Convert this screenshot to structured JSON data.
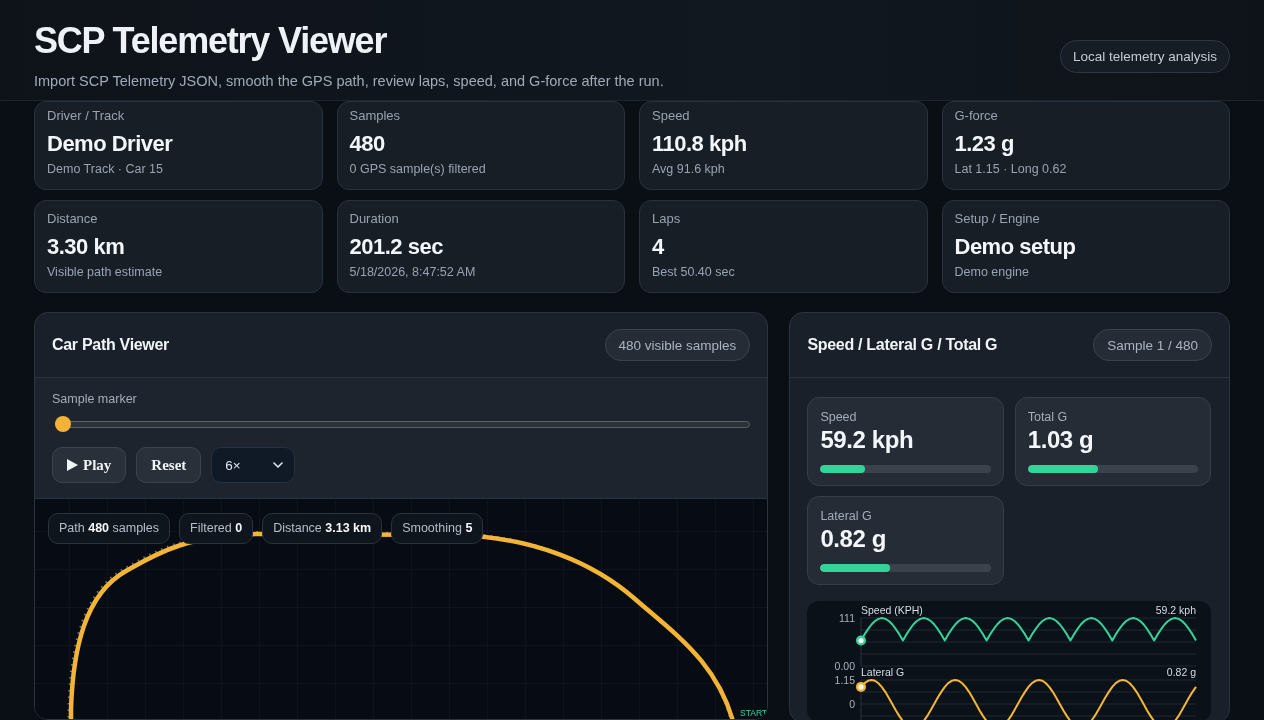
{
  "header": {
    "title": "SCP Telemetry Viewer",
    "subtitle": "Import SCP Telemetry JSON, smooth the GPS path, review laps, speed, and G-force after the run.",
    "badge": "Local telemetry analysis"
  },
  "stats": [
    {
      "label": "Driver / Track",
      "value": "Demo Driver",
      "detail": "Demo Track · Car 15"
    },
    {
      "label": "Samples",
      "value": "480",
      "detail": "0 GPS sample(s) filtered"
    },
    {
      "label": "Speed",
      "value": "110.8 kph",
      "detail": "Avg 91.6 kph"
    },
    {
      "label": "G-force",
      "value": "1.23 g",
      "detail": "Lat 1.15 · Long 0.62"
    },
    {
      "label": "Distance",
      "value": "3.30 km",
      "detail": "Visible path estimate"
    },
    {
      "label": "Duration",
      "value": "201.2 sec",
      "detail": "5/18/2026, 8:47:52 AM"
    },
    {
      "label": "Laps",
      "value": "4",
      "detail": "Best 50.40 sec"
    },
    {
      "label": "Setup / Engine",
      "value": "Demo setup",
      "detail": "Demo engine"
    }
  ],
  "path_viewer": {
    "title": "Car Path Viewer",
    "badge": "480 visible samples",
    "slider": {
      "label": "Sample marker",
      "level": 0
    },
    "buttons": [
      {
        "kind": "play",
        "label": "Play"
      },
      {
        "kind": "reset",
        "label": "Reset"
      }
    ],
    "speed_select": {
      "value": "6×"
    },
    "chips": [
      "Path **480** samples",
      "Filtered **0**",
      "Distance **3.13 km**",
      "Smoothing **5**"
    ],
    "start_label": "START"
  },
  "telemetry": {
    "title": "Speed / Lateral G / Total G",
    "badge": "Sample 1 / 480",
    "metrics": [
      {
        "label": "Speed",
        "value": "59.2 kph",
        "level": 0.26
      },
      {
        "label": "Total G",
        "value": "1.03 g",
        "level": 0.41
      },
      {
        "label": "Lateral G",
        "value": "0.82 g",
        "level": 0.41
      }
    ],
    "charts": [
      {
        "reading": "59.2 kph",
        "chart_data": {
          "type": "line",
          "title": "Speed (KPH)",
          "categories": [
            null,
            null,
            null,
            null,
            null,
            null,
            null,
            null,
            null,
            null,
            null,
            null,
            null,
            null,
            null,
            null,
            null,
            null,
            null,
            null,
            null,
            null,
            null,
            null,
            null,
            null,
            null,
            null,
            null,
            null,
            null,
            null,
            null,
            null,
            null,
            null,
            null,
            null,
            null,
            null,
            null,
            null,
            null,
            null,
            null,
            null,
            null,
            null,
            null,
            null,
            null,
            null,
            null,
            null,
            null,
            null,
            null,
            null,
            null,
            null,
            null,
            null,
            null,
            null,
            null,
            null,
            null,
            null,
            null,
            null,
            null,
            null,
            null,
            null,
            null,
            null,
            null,
            null,
            null,
            null,
            null,
            null,
            null,
            null,
            null,
            null,
            null,
            null,
            null,
            null,
            null,
            null,
            null,
            null,
            null,
            null,
            null
          ],
          "series": [
            {
              "color": "#34d399",
              "values": [
                59,
                73,
                85,
                96,
                104,
                109,
                111,
                109,
                104,
                96,
                85,
                73,
                59,
                73,
                85,
                96,
                104,
                109,
                111,
                109,
                104,
                96,
                85,
                73,
                59,
                73,
                85,
                96,
                104,
                109,
                111,
                109,
                104,
                96,
                85,
                73,
                59,
                73,
                85,
                96,
                104,
                109,
                111,
                109,
                104,
                96,
                85,
                73,
                59,
                73,
                85,
                96,
                104,
                109,
                111,
                109,
                104,
                96,
                85,
                73,
                59,
                73,
                85,
                96,
                104,
                109,
                111,
                109,
                104,
                96,
                85,
                73,
                59,
                73,
                85,
                96,
                104,
                109,
                111,
                109,
                104,
                96,
                85,
                73,
                59,
                73,
                85,
                96,
                104,
                109,
                111,
                109,
                104,
                96,
                85,
                73,
                59
              ]
            }
          ],
          "ylim": [
            0,
            111
          ],
          "yticks": [
            {
              "value": 0,
              "label": "0.00"
            },
            {
              "value": 111,
              "label": "111"
            }
          ]
        }
      },
      {
        "reading": "0.82 g",
        "chart_data": {
          "type": "line",
          "title": "Lateral G",
          "categories": [
            null,
            null,
            null,
            null,
            null,
            null,
            null,
            null,
            null,
            null,
            null,
            null,
            null,
            null,
            null,
            null,
            null,
            null,
            null,
            null,
            null,
            null,
            null,
            null,
            null,
            null,
            null,
            null,
            null,
            null,
            null,
            null,
            null,
            null,
            null,
            null,
            null,
            null,
            null,
            null,
            null,
            null,
            null,
            null,
            null,
            null,
            null,
            null,
            null,
            null,
            null,
            null,
            null,
            null,
            null,
            null,
            null,
            null,
            null,
            null,
            null,
            null,
            null,
            null,
            null,
            null,
            null,
            null,
            null,
            null,
            null,
            null,
            null,
            null,
            null,
            null,
            null,
            null,
            null,
            null,
            null,
            null,
            null,
            null,
            null,
            null,
            null,
            null,
            null,
            null,
            null,
            null,
            null,
            null,
            null,
            null,
            null
          ],
          "series": [
            {
              "color": "#f5b731",
              "values": [
                0.82,
                1,
                1.11,
                1.15,
                1.11,
                0.99,
                0.81,
                0.57,
                0.29,
                -0.01,
                -0.31,
                -0.58,
                -0.82,
                -1,
                null,
                null,
                null,
                -0.99,
                -0.81,
                -0.57,
                -0.29,
                0.01,
                0.31,
                0.58,
                0.82,
                1,
                1.11,
                1.15,
                1.11,
                0.99,
                0.81,
                0.57,
                0.29,
                -0.01,
                -0.31,
                -0.58,
                -0.82,
                -1,
                null,
                null,
                null,
                -0.99,
                -0.81,
                -0.57,
                -0.29,
                0.01,
                0.31,
                0.58,
                0.82,
                1,
                1.11,
                1.15,
                1.11,
                0.99,
                0.81,
                0.57,
                0.29,
                -0.01,
                -0.31,
                -0.58,
                -0.82,
                -1,
                null,
                null,
                null,
                -0.99,
                -0.81,
                -0.57,
                -0.29,
                0.01,
                0.31,
                0.58,
                0.82,
                1,
                1.11,
                1.15,
                1.11,
                0.99,
                0.81,
                0.57,
                0.29,
                -0.01,
                -0.31,
                -0.58,
                -0.82,
                -1,
                null,
                null,
                null,
                -0.99,
                -0.81,
                -0.57,
                -0.29,
                0.01,
                0.31,
                0.58,
                0.82
              ]
            }
          ],
          "ylim": [
            -1.15,
            1.15
          ],
          "yticks": [
            {
              "value": 1.15,
              "label": "1.15"
            },
            {
              "value": 0,
              "label": "0"
            }
          ]
        }
      }
    ]
  }
}
